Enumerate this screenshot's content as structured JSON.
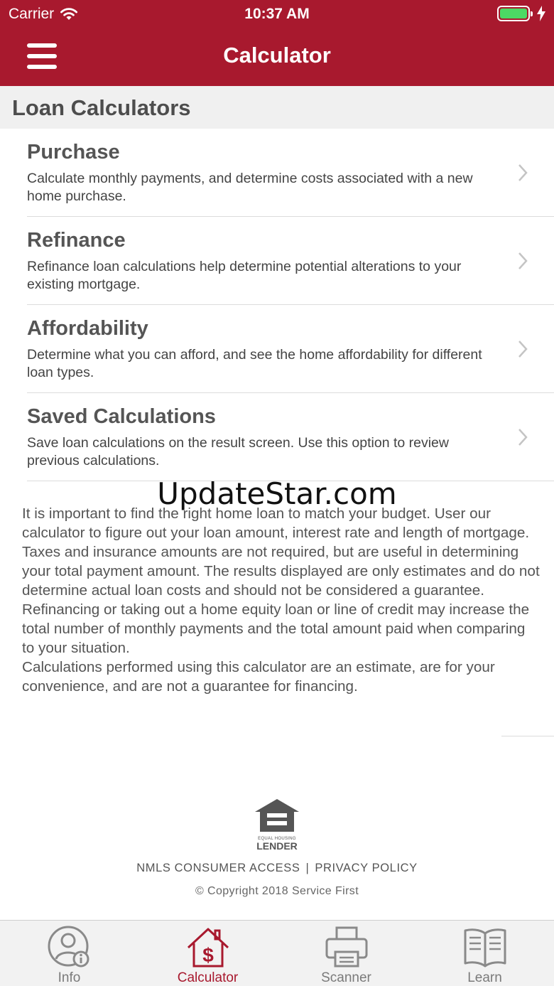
{
  "status_bar": {
    "carrier": "Carrier",
    "time": "10:37 AM"
  },
  "nav": {
    "title": "Calculator"
  },
  "section": {
    "title": "Loan Calculators"
  },
  "items": [
    {
      "title": "Purchase",
      "desc": "Calculate monthly payments, and determine costs associated with a new home purchase."
    },
    {
      "title": "Refinance",
      "desc": "Refinance loan calculations help determine potential alterations to your existing mortgage."
    },
    {
      "title": "Affordability",
      "desc": "Determine what you can afford, and see the home affordability for different loan types."
    },
    {
      "title": "Saved Calculations",
      "desc": "Save loan calculations on the result screen. Use this option to review previous calculations."
    }
  ],
  "watermark": "UpdateStar.com",
  "disclaimer": {
    "p1": "It is important to find the right home loan to match your budget. User our calculator to figure out your loan amount, interest rate and length of mortgage. Taxes and insurance amounts are not required, but are useful in determining your total payment amount. The results displayed are only estimates and do not determine actual loan costs and should not be considered a guarantee. Refinancing or taking out a home equity loan or line of credit may increase the total number of monthly payments and the total amount paid when comparing to your situation.",
    "p2": "Calculations performed using this calculator are an estimate, are for your convenience, and are not a guarantee for financing."
  },
  "footer": {
    "ehl_line1": "EQUAL HOUSING",
    "ehl_line2": "LENDER",
    "nmls": "NMLS CONSUMER ACCESS",
    "separator": "|",
    "privacy": "PRIVACY POLICY",
    "copyright": "© Copyright 2018 Service First"
  },
  "tabs": [
    {
      "label": "Info",
      "icon": "user-info-icon"
    },
    {
      "label": "Calculator",
      "icon": "house-dollar-icon",
      "active": true
    },
    {
      "label": "Scanner",
      "icon": "printer-icon"
    },
    {
      "label": "Learn",
      "icon": "book-icon"
    }
  ],
  "colors": {
    "brand": "#a8192e",
    "battery": "#4cd964",
    "inactive_tab": "#7a7a7a"
  }
}
